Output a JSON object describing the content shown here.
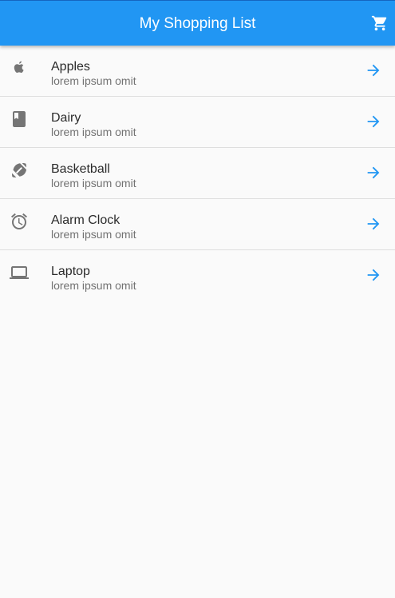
{
  "appbar": {
    "title": "My Shopping List",
    "cart_icon": "shopping-cart-icon",
    "color": "#2196f3"
  },
  "items": [
    {
      "title": "Apples",
      "subtitle": "lorem ipsum omit",
      "icon": "apple-icon"
    },
    {
      "title": "Dairy",
      "subtitle": "lorem ipsum omit",
      "icon": "book-icon"
    },
    {
      "title": "Basketball",
      "subtitle": "lorem ipsum omit",
      "icon": "football-icon"
    },
    {
      "title": "Alarm Clock",
      "subtitle": "lorem ipsum omit",
      "icon": "alarm-clock-icon"
    },
    {
      "title": "Laptop",
      "subtitle": "lorem ipsum omit",
      "icon": "laptop-icon"
    }
  ],
  "trailing_icon": "arrow-forward-icon",
  "colors": {
    "accent": "#2196f3",
    "icon_grey": "#757575",
    "divider": "#dedede",
    "background": "#fafafa"
  }
}
